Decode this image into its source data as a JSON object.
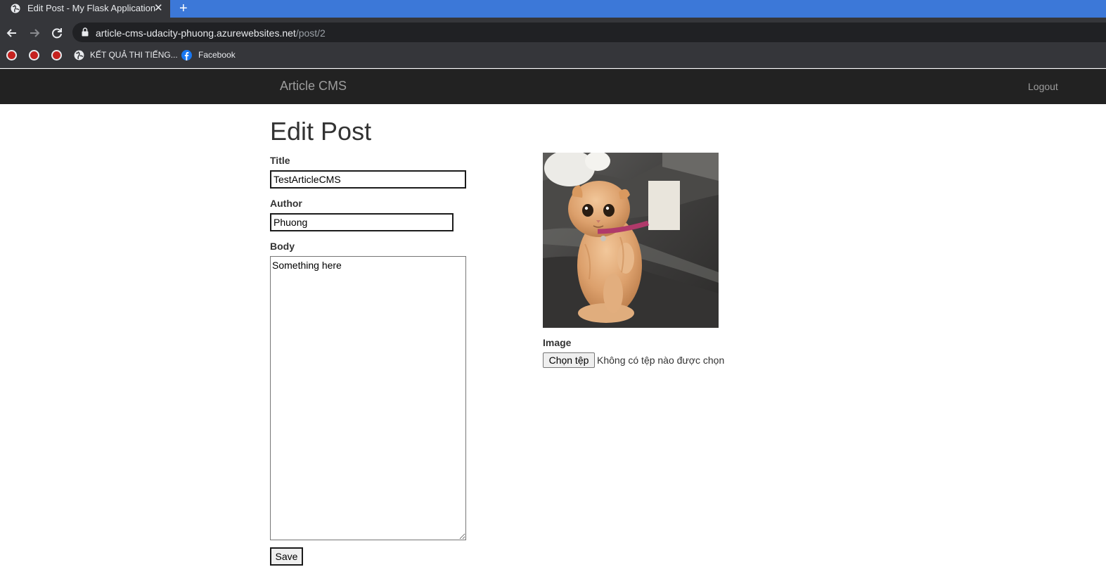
{
  "browser": {
    "tab_title": "Edit Post - My Flask Application",
    "close_glyph": "✕",
    "newtab_glyph": "+",
    "url_host": "article-cms-udacity-phuong.azurewebsites.net",
    "url_path": "/post/2",
    "bookmarks": [
      {
        "label": "KẾT QUẢ THI TIẾNG..."
      },
      {
        "label": "Facebook"
      }
    ],
    "colors": {
      "tabstrip": "#3c78d8",
      "chrome": "#35363a",
      "omnibox": "#202124"
    }
  },
  "navbar": {
    "brand": "Article CMS",
    "logout": "Logout"
  },
  "form": {
    "heading": "Edit Post",
    "title_label": "Title",
    "title_value": "TestArticleCMS",
    "author_label": "Author",
    "author_value": "Phuong",
    "body_label": "Body",
    "body_value": "Something here",
    "image_label": "Image",
    "file_button": "Chọn tệp",
    "file_status": "Không có tệp nào được chọn",
    "save_label": "Save"
  }
}
